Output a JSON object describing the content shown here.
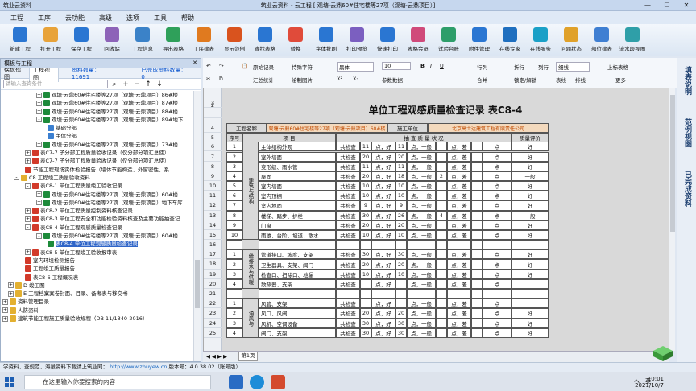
{
  "window": {
    "app": "筑业云资料",
    "title": "筑业云资料 - 云工程 [ 观塘·云鼎60#住宅楼等27项（观塘·云鼎项目）]",
    "min": "—",
    "max": "☐",
    "close": "✕"
  },
  "menu": [
    "工程",
    "工序",
    "云功能",
    "高级",
    "选项",
    "工具",
    "帮助"
  ],
  "toolbar": [
    "新建工程",
    "打开工程",
    "保存工程",
    "回收站",
    "工程信息",
    "导出表格",
    "工序建表",
    "显示范例",
    "查找表格",
    "替换",
    "字体批刷",
    "打印预览",
    "快速打印",
    "表格会员",
    "试验台账",
    "附件管理",
    "在线专家",
    "在线服务",
    "问题状态",
    "部位建表",
    "流水段视图"
  ],
  "toolbar_colors": [
    "#2a76d2",
    "#e8a33a",
    "#2a76d2",
    "#8d63b8",
    "#3b82c8",
    "#2fa05a",
    "#e07a1f",
    "#d9531e",
    "#2a76d2",
    "#e04b3a",
    "#2a76d2",
    "#7b5fc0",
    "#2a76d2",
    "#d04a7a",
    "#2e9e6a",
    "#2a76d2",
    "#1f6fbf",
    "#1aa0c7",
    "#e0a12a",
    "#3f7fd2",
    "#2f9fa8"
  ],
  "left": {
    "header": "模板与工程",
    "close": "✕",
    "tabs": [
      "模板视图",
      "工程视图"
    ],
    "count_label": "资料数量：",
    "count": "11691",
    "done_label": "已完成资料数量：",
    "done": "0",
    "search_placeholder": "请输入查询条件"
  },
  "tree": [
    {
      "i": 6,
      "e": "+",
      "c": "#1d8a3a",
      "t": "观塘·云鼎60#住宅楼等27项（观塘·云鼎项目）86#楼"
    },
    {
      "i": 6,
      "e": "+",
      "c": "#1d8a3a",
      "t": "观塘·云鼎60#住宅楼等27项（观塘·云鼎项目）87#楼"
    },
    {
      "i": 6,
      "e": "+",
      "c": "#1d8a3a",
      "t": "观塘·云鼎60#住宅楼等27项（观塘·云鼎项目）88#楼"
    },
    {
      "i": 6,
      "e": "-",
      "c": "#1d8a3a",
      "t": "观塘·云鼎60#住宅楼等27项（观塘·云鼎项目）89#地下"
    },
    {
      "i": 8,
      "e": "",
      "c": "#3b7fd0",
      "t": "基础分部"
    },
    {
      "i": 8,
      "e": "",
      "c": "#3b7fd0",
      "t": "主体分部"
    },
    {
      "i": 6,
      "e": "+",
      "c": "#1d8a3a",
      "t": "观塘·云鼎60#住宅楼等27项（观塘·云鼎项目）73#楼"
    },
    {
      "i": 4,
      "e": "+",
      "c": "#d23a2a",
      "t": "表C7-7  子分部工程质量验收记录（仅分部分项汇总使）"
    },
    {
      "i": 4,
      "e": "+",
      "c": "#d23a2a",
      "t": "表C7-7  子分部工程质量验收记录（仅分部分项汇总使）"
    },
    {
      "i": 4,
      "e": "",
      "c": "#d23a2a",
      "t": "节能工程现场实体检验报告（墙体节能构造、外窗密性、系"
    },
    {
      "i": 2,
      "e": "-",
      "c": "#e3b030",
      "t": "C8 工程竣工质量验收资料"
    },
    {
      "i": 4,
      "e": "-",
      "c": "#d23a2a",
      "t": "表C8-1  单位工程质量竣工验收记录"
    },
    {
      "i": 6,
      "e": "+",
      "c": "#1d8a3a",
      "t": "观塘·云鼎60#住宅楼等27项（观塘·云鼎项目）60#楼"
    },
    {
      "i": 6,
      "e": "+",
      "c": "#1d8a3a",
      "t": "观塘·云鼎60#住宅楼等27项（观塘·云鼎项目）地下车库"
    },
    {
      "i": 4,
      "e": "+",
      "c": "#d23a2a",
      "t": "表C8-2  单位工程质量控制资料核查记录"
    },
    {
      "i": 4,
      "e": "+",
      "c": "#d23a2a",
      "t": "表C8-3  单位工程安全和功能检验资料核查及主要功能抽查记"
    },
    {
      "i": 4,
      "e": "-",
      "c": "#d23a2a",
      "t": "表C8-4  单位工程观感质量检查记录"
    },
    {
      "i": 6,
      "e": "-",
      "c": "#1d8a3a",
      "t": "观塘·云鼎60#住宅楼等27项（观塘·云鼎项目）60#楼"
    },
    {
      "i": 8,
      "e": "",
      "c": "#1d8a3a",
      "t": "表C8-4 单位工程观感质量检查记录",
      "sel": true
    },
    {
      "i": 4,
      "e": "+",
      "c": "#d23a2a",
      "t": "表C8-5  单位工程竣工验收报审表"
    },
    {
      "i": 4,
      "e": "",
      "c": "#d23a2a",
      "t": "室内环境检测报告"
    },
    {
      "i": 4,
      "e": "",
      "c": "#d23a2a",
      "t": "工程竣工质量报告"
    },
    {
      "i": 4,
      "e": "",
      "c": "#d23a2a",
      "t": "表C8-6  工程概况表"
    },
    {
      "i": 1,
      "e": "+",
      "c": "#e3b030",
      "t": "D 竣工图"
    },
    {
      "i": 1,
      "e": "+",
      "c": "#e3b030",
      "t": "E 工程档案案卷封面、目录、备考表与移交书"
    },
    {
      "i": 0,
      "e": "+",
      "c": "#e3b030",
      "t": "资料管理目录"
    },
    {
      "i": 0,
      "e": "+",
      "c": "#e3b030",
      "t": "人防资料"
    },
    {
      "i": 0,
      "e": "+",
      "c": "#e3b030",
      "t": "建筑节能工程施工质量验收规程（DB 11/1340-2016）"
    }
  ],
  "ribbon": {
    "insert_record": "原始记录",
    "special_char": "特殊字符",
    "font": "黑体",
    "size": "10",
    "summary": "汇总统计",
    "draw_pic": "绘制图片",
    "superscript": "X²",
    "subscript": "X₂",
    "param_data": "参数数据",
    "rows": "行列",
    "merge": "合并",
    "split": "折行",
    "rowh": "列行",
    "lock": "锁定/解锁",
    "border": "细线",
    "line_style": "排线",
    "wire": "表线",
    "table_add": "上标表格",
    "more": "更多"
  },
  "sheet": {
    "title": "单位工程观感质量检查记录  表C8-4",
    "project_label": "工程名称",
    "project_name": "观塘·云鼎60#住宅楼等27项（观塘·云鼎项目）60#楼",
    "unit_label": "施工单位",
    "unit_name": "北京高士达建筑工程有限责任公司",
    "h_seq": "序号",
    "h_item": "项   目",
    "h_sample": "抽  查  质  量  状  况",
    "h_eval": "质量评价",
    "g1": "建筑与结构",
    "g2": "给排水与供暖",
    "g3": "通风与",
    "rows": [
      {
        "r": "6",
        "n": "1",
        "t": "主体结构外观",
        "q": "共检查",
        "a": "11",
        "b": "点，好",
        "c": "11",
        "d": "点，一般",
        "e": "",
        "f": "点，差",
        "g": "",
        "h": "点",
        "v": "好"
      },
      {
        "r": "7",
        "n": "2",
        "t": "室外墙面",
        "q": "共检查",
        "a": "20",
        "b": "点，好",
        "c": "20",
        "d": "点，一般",
        "e": "",
        "f": "点，差",
        "g": "",
        "h": "点",
        "v": "好"
      },
      {
        "r": "8",
        "n": "3",
        "t": "变形缝、雨水管",
        "q": "共检查",
        "a": "11",
        "b": "点，好",
        "c": "11",
        "d": "点，一般",
        "e": "",
        "f": "点，差",
        "g": "",
        "h": "点",
        "v": "好"
      },
      {
        "r": "9",
        "n": "4",
        "t": "屋面",
        "q": "共检查",
        "a": "20",
        "b": "点，好",
        "c": "18",
        "d": "点，一般",
        "e": "2",
        "f": "点，差",
        "g": "",
        "h": "点",
        "v": "一般"
      },
      {
        "r": "10",
        "n": "5",
        "t": "室内墙面",
        "q": "共检查",
        "a": "10",
        "b": "点，好",
        "c": "10",
        "d": "点，一般",
        "e": "",
        "f": "点，差",
        "g": "",
        "h": "点",
        "v": "好"
      },
      {
        "r": "11",
        "n": "6",
        "t": "室内顶棚",
        "q": "共检查",
        "a": "10",
        "b": "点，好",
        "c": "10",
        "d": "点，一般",
        "e": "",
        "f": "点，差",
        "g": "",
        "h": "点",
        "v": "好"
      },
      {
        "r": "12",
        "n": "7",
        "t": "室内地面",
        "q": "共检查",
        "a": "9",
        "b": "点，好",
        "c": "9",
        "d": "点，一般",
        "e": "",
        "f": "点，差",
        "g": "",
        "h": "点",
        "v": "好"
      },
      {
        "r": "13",
        "n": "8",
        "t": "楼梯、踏步、护栏",
        "q": "共检查",
        "a": "30",
        "b": "点，好",
        "c": "26",
        "d": "点，一般",
        "e": "4",
        "f": "点，差",
        "g": "",
        "h": "点",
        "v": "一般"
      },
      {
        "r": "14",
        "n": "9",
        "t": "门窗",
        "q": "共检查",
        "a": "20",
        "b": "点，好",
        "c": "20",
        "d": "点，一般",
        "e": "",
        "f": "点，差",
        "g": "",
        "h": "点",
        "v": "好"
      },
      {
        "r": "15",
        "n": "10",
        "t": "雨罩、台阶、坡道、散水",
        "q": "共检查",
        "a": "10",
        "b": "点，好",
        "c": "10",
        "d": "点，一般",
        "e": "",
        "f": "点，差",
        "g": "",
        "h": "点",
        "v": "好"
      },
      {
        "r": "16",
        "n": "",
        "t": "",
        "q": "",
        "a": "",
        "b": "",
        "c": "",
        "d": "",
        "e": "",
        "f": "",
        "g": "",
        "h": "",
        "v": ""
      },
      {
        "r": "17",
        "n": "1",
        "t": "管道接口、坡度、支架",
        "q": "共检查",
        "a": "30",
        "b": "点，好",
        "c": "30",
        "d": "点，一般",
        "e": "",
        "f": "点，差",
        "g": "",
        "h": "点",
        "v": "好"
      },
      {
        "r": "18",
        "n": "2",
        "t": "卫生器具、支架、阀门",
        "q": "共检查",
        "a": "20",
        "b": "点，好",
        "c": "20",
        "d": "点，一般",
        "e": "",
        "f": "点，差",
        "g": "",
        "h": "点",
        "v": "好"
      },
      {
        "r": "19",
        "n": "3",
        "t": "检查口、扫除口、地漏",
        "q": "共检查",
        "a": "10",
        "b": "点，好",
        "c": "10",
        "d": "点，一般",
        "e": "",
        "f": "点，差",
        "g": "",
        "h": "点",
        "v": "好"
      },
      {
        "r": "20",
        "n": "4",
        "t": "散热器、支架",
        "q": "共检查",
        "a": "",
        "b": "点，好",
        "c": "",
        "d": "点，一般",
        "e": "",
        "f": "点，差",
        "g": "",
        "h": "点",
        "v": ""
      },
      {
        "r": "21",
        "n": "",
        "t": "",
        "q": "",
        "a": "",
        "b": "",
        "c": "",
        "d": "",
        "e": "",
        "f": "",
        "g": "",
        "h": "",
        "v": ""
      },
      {
        "r": "22",
        "n": "1",
        "t": "风管、支架",
        "q": "共检查",
        "a": "",
        "b": "点，好",
        "c": "",
        "d": "点，一般",
        "e": "",
        "f": "点，差",
        "g": "",
        "h": "点",
        "v": ""
      },
      {
        "r": "23",
        "n": "2",
        "t": "风口、风阀",
        "q": "共检查",
        "a": "20",
        "b": "点，好",
        "c": "20",
        "d": "点，一般",
        "e": "",
        "f": "点，差",
        "g": "",
        "h": "点",
        "v": "好"
      },
      {
        "r": "24",
        "n": "3",
        "t": "风机、空调设备",
        "q": "共检查",
        "a": "30",
        "b": "点，好",
        "c": "30",
        "d": "点，一般",
        "e": "",
        "f": "点，差",
        "g": "",
        "h": "点",
        "v": "好"
      },
      {
        "r": "25",
        "n": "4",
        "t": "阀门、支架",
        "q": "共检查",
        "a": "30",
        "b": "点，好",
        "c": "30",
        "d": "点，一般",
        "e": "",
        "f": "点，差",
        "g": "",
        "h": "点",
        "v": "好"
      }
    ],
    "tab": "第1页"
  },
  "side": [
    "填表说明",
    "范例视图",
    "已完成资料"
  ],
  "status": {
    "left": "学资料、查规范、海量资料下载请上筑业网：",
    "url": "http://www.zhuyew.cn",
    "ver": "  版本号：4.0.38.02（账号版）"
  },
  "taskbar": {
    "search": "在这里输入你要搜索的内容",
    "time": "10:01",
    "date": "2021/10/7",
    "ime": "英",
    "lang": "へ"
  }
}
